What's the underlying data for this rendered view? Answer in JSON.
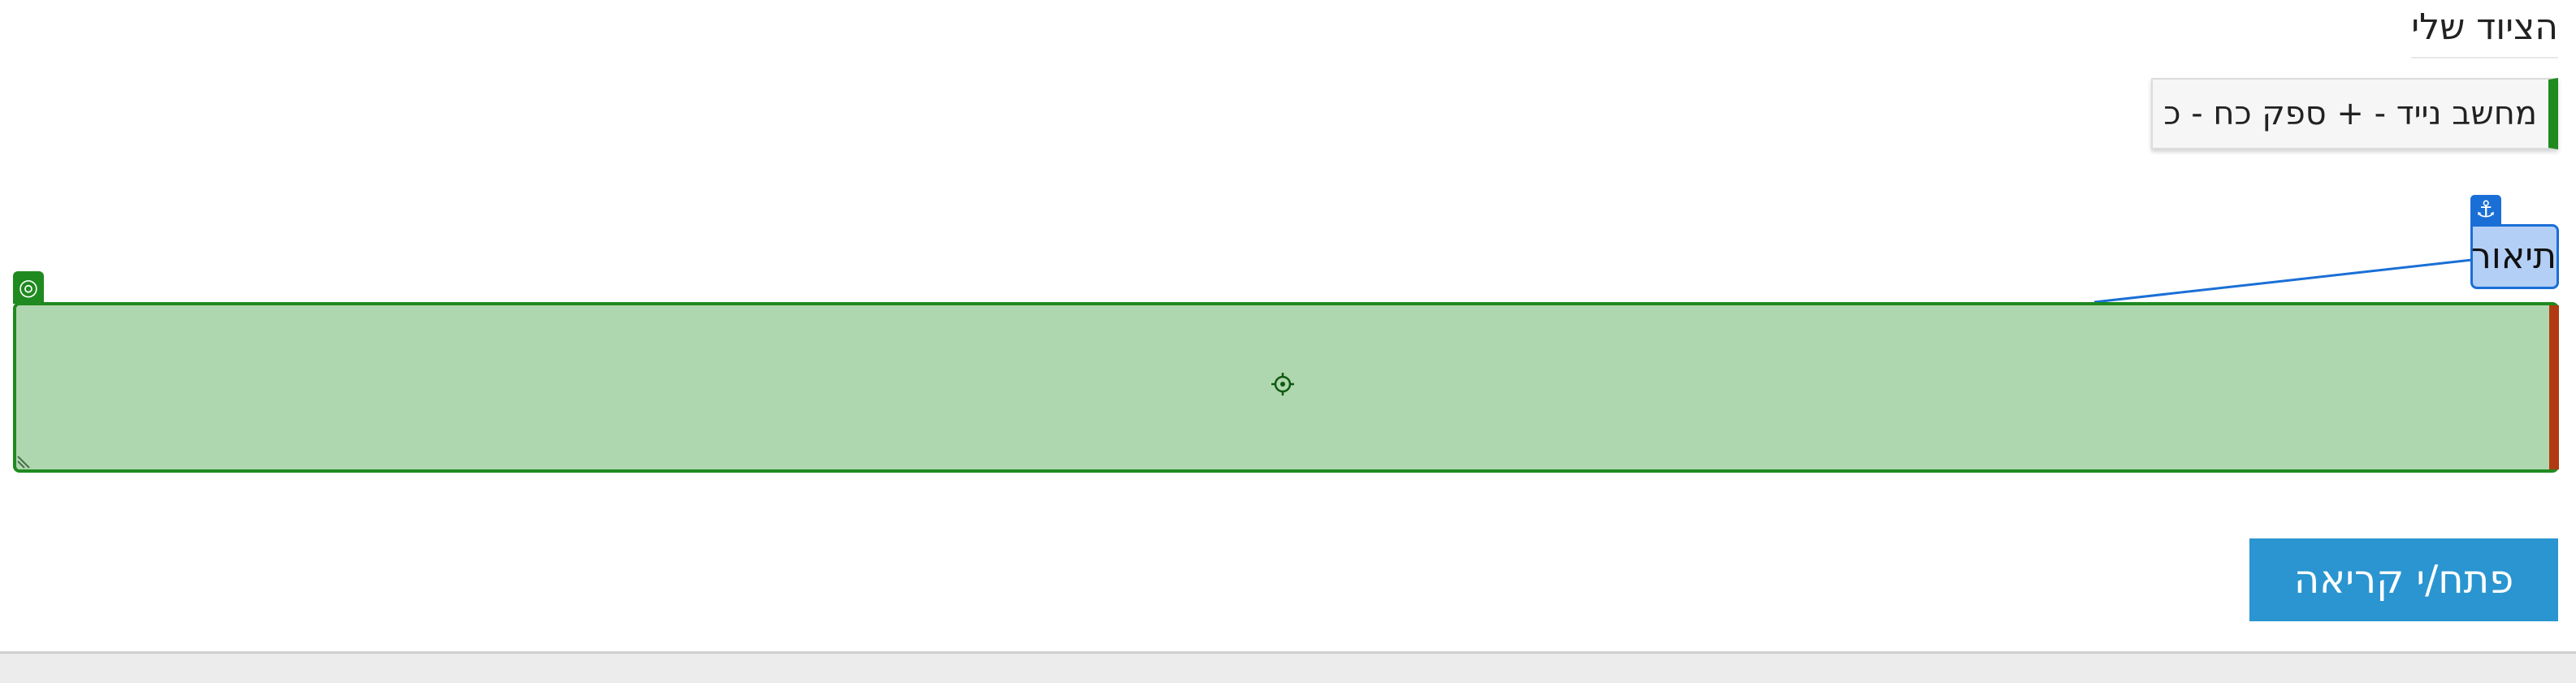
{
  "equipment": {
    "title": "הציוד שלי",
    "item_label": "מחשב נייד - + ספק כח - כ"
  },
  "description": {
    "label": "תיאור",
    "value": ""
  },
  "actions": {
    "open_ticket_label": "פתח/י קריאה"
  },
  "icons": {
    "anchor": "anchor-icon",
    "target": "target-icon",
    "crosshair": "crosshair-icon",
    "resize": "resize-handle-icon"
  },
  "colors": {
    "field_fill": "#afd7af",
    "field_border": "#1f8a1f",
    "label_fill": "#b4cff5",
    "label_border": "#1a6fd6",
    "accent_red": "#b23a12",
    "button": "#2a95d0"
  }
}
